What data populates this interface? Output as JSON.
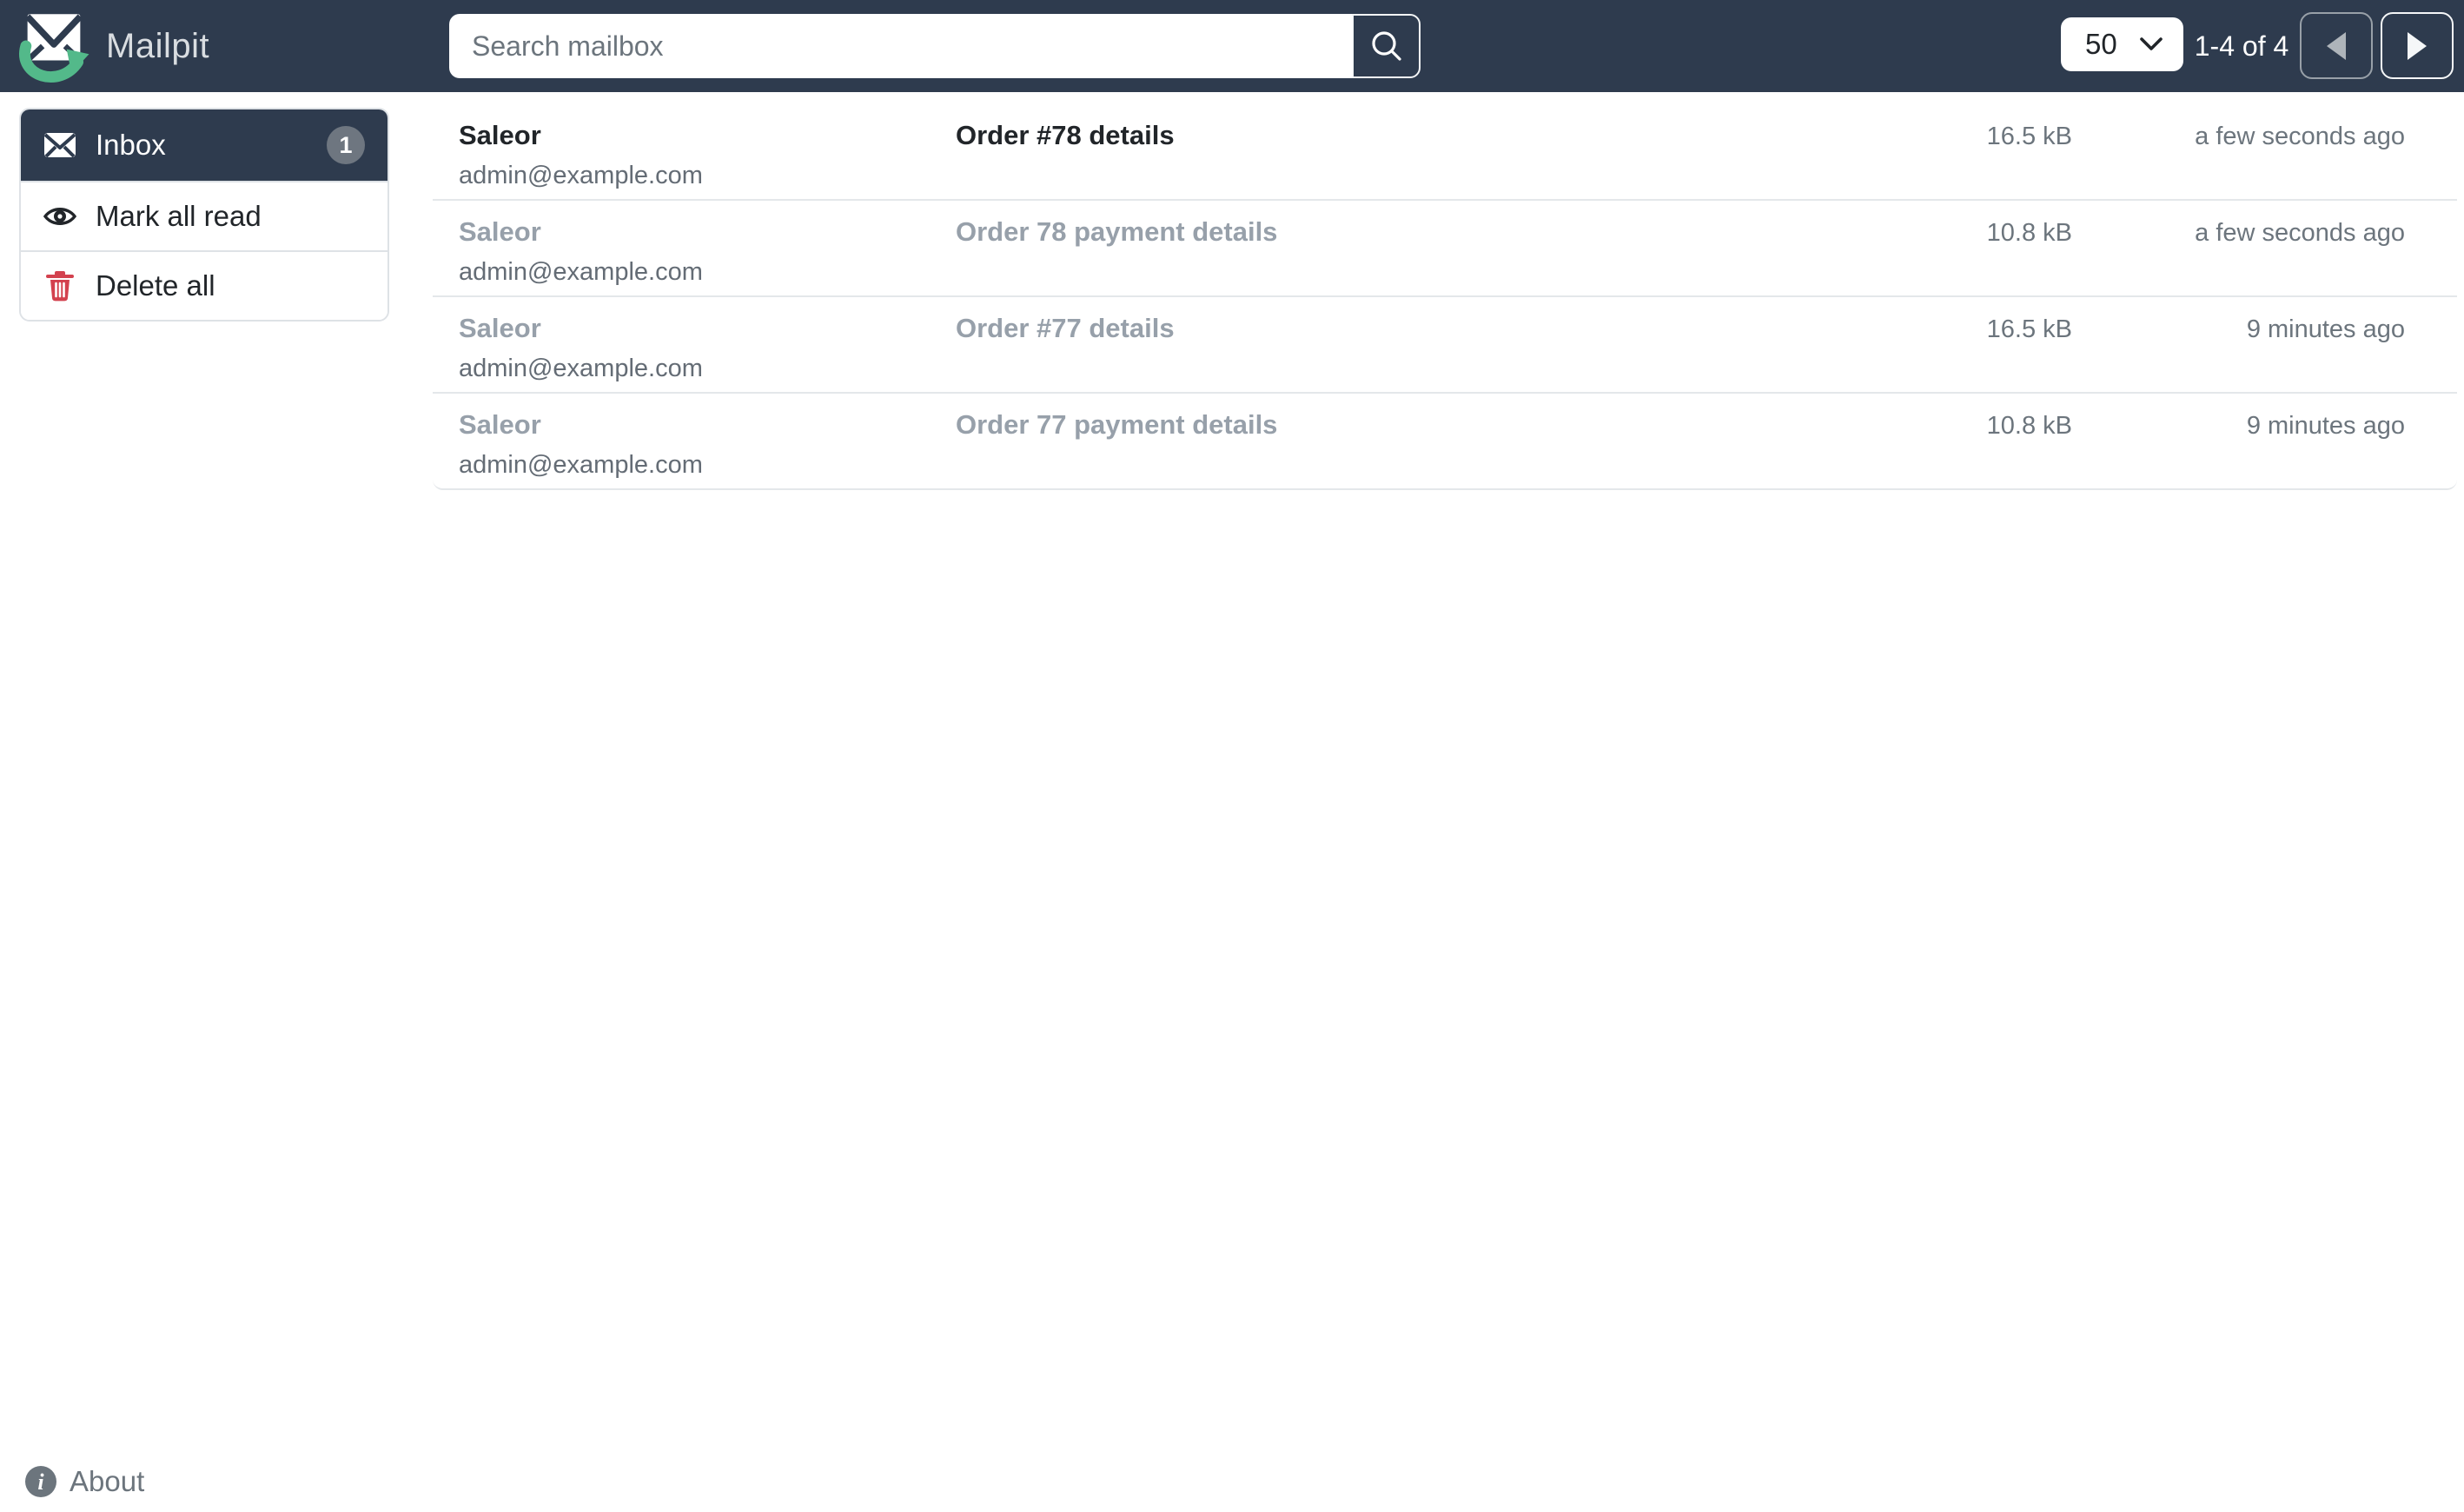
{
  "navbar": {
    "brand": "Mailpit",
    "search": {
      "placeholder": "Search mailbox"
    },
    "page_size": "50",
    "pagination_label": "1-4 of 4"
  },
  "sidebar": {
    "items": [
      {
        "label": "Inbox",
        "badge": "1",
        "icon": "envelope-icon"
      },
      {
        "label": "Mark all read",
        "icon": "eye-icon"
      },
      {
        "label": "Delete all",
        "icon": "trash-icon"
      }
    ]
  },
  "messages": [
    {
      "from_name": "Saleor",
      "from_email": "admin@example.com",
      "subject": "Order #78 details",
      "size": "16.5 kB",
      "time": "a few seconds ago",
      "unread": true
    },
    {
      "from_name": "Saleor",
      "from_email": "admin@example.com",
      "subject": "Order 78 payment details",
      "size": "10.8 kB",
      "time": "a few seconds ago",
      "unread": false
    },
    {
      "from_name": "Saleor",
      "from_email": "admin@example.com",
      "subject": "Order #77 details",
      "size": "16.5 kB",
      "time": "9 minutes ago",
      "unread": false
    },
    {
      "from_name": "Saleor",
      "from_email": "admin@example.com",
      "subject": "Order 77 payment details",
      "size": "10.8 kB",
      "time": "9 minutes ago",
      "unread": false
    }
  ],
  "footer": {
    "about_label": "About"
  },
  "icons": {
    "brand": "mailpit-logo",
    "search": "magnifier-icon",
    "page_size": "chevron-down-icon",
    "prev": "caret-left-icon",
    "next": "caret-right-icon",
    "about": "info-circle-icon"
  },
  "colors": {
    "navbar_bg": "#2e3b4e",
    "brand_green": "#53b98a",
    "unread_text": "#212529",
    "read_muted_text": "#97a0aa",
    "secondary_text": "#6c757d",
    "badge_bg": "#6e7680",
    "danger_red": "#d3414e",
    "divider": "#e4e7ea"
  }
}
